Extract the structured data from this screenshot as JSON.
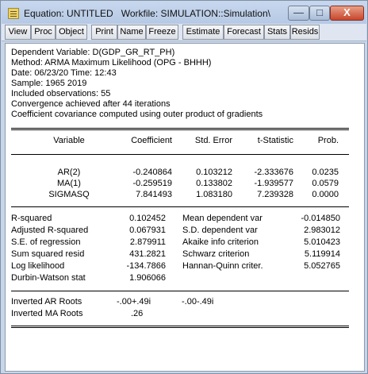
{
  "window": {
    "title": "Equation: UNTITLED   Workfile: SIMULATION::Simulation\\",
    "min_label": "—",
    "max_label": "□",
    "close_label": "X"
  },
  "toolbar": [
    "View",
    "Proc",
    "Object",
    "Print",
    "Name",
    "Freeze",
    "Estimate",
    "Forecast",
    "Stats",
    "Resids"
  ],
  "header": [
    "Dependent Variable: D(GDP_GR_RT_PH)",
    "Method: ARMA Maximum Likelihood (OPG - BHHH)",
    "Date: 06/23/20   Time: 12:43",
    "Sample: 1965 2019",
    "Included observations: 55",
    "Convergence achieved after 44 iterations",
    "Coefficient covariance computed using outer product of gradients"
  ],
  "coef_table": {
    "columns": [
      "Variable",
      "Coefficient",
      "Std. Error",
      "t-Statistic",
      "Prob."
    ],
    "rows": [
      [
        "AR(2)",
        "-0.240864",
        "0.103212",
        "-2.333676",
        "0.0235"
      ],
      [
        "MA(1)",
        "-0.259519",
        "0.133802",
        "-1.939577",
        "0.0579"
      ],
      [
        "SIGMASQ",
        "7.841493",
        "1.083180",
        "7.239328",
        "0.0000"
      ]
    ]
  },
  "stats": [
    [
      "R-squared",
      "0.102452",
      "Mean dependent var",
      "-0.014850"
    ],
    [
      "Adjusted R-squared",
      "0.067931",
      "S.D. dependent var",
      "2.983012"
    ],
    [
      "S.E. of regression",
      "2.879911",
      "Akaike info criterion",
      "5.010423"
    ],
    [
      "Sum squared resid",
      "431.2821",
      "Schwarz criterion",
      "5.119914"
    ],
    [
      "Log likelihood",
      "-134.7866",
      "Hannan-Quinn criter.",
      "5.052765"
    ],
    [
      "Durbin-Watson stat",
      "1.906066",
      "",
      ""
    ]
  ],
  "roots": [
    {
      "label": "Inverted AR Roots",
      "values": [
        "-.00+.49i",
        "-.00-.49i"
      ]
    },
    {
      "label": "Inverted MA Roots",
      "values": [
        ".26"
      ]
    }
  ]
}
